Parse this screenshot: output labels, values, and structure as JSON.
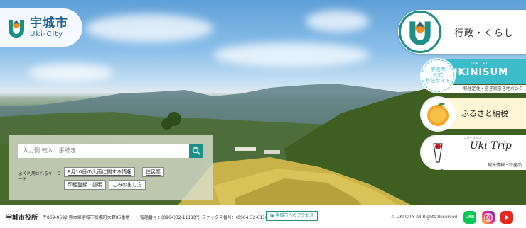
{
  "header": {
    "logo_main": "宇城市",
    "logo_sub": "Uki-City"
  },
  "side_panel": {
    "admin_label": "行政・くらし",
    "ukinisum": {
      "badge_top": "宇城市",
      "badge_mid": "公式",
      "badge_bottom": "移住サイト",
      "kana": "ウキニスム",
      "title": "UKINISUM",
      "caption": "移住定住・空き家空き地バンク"
    },
    "furusato": {
      "title": "ふるさと納税"
    },
    "ukitrip": {
      "kana": "ユキトリップ",
      "title": "Uki Trip",
      "caption": "観光情報・特産品"
    }
  },
  "search": {
    "placeholder": "入力例:転入　手続き",
    "keywords_label": "よく利用されるキーワード",
    "keywords": [
      "8月10日の大雨に関する情報",
      "住民票",
      "印鑑登録・証明",
      "ごみの出し方"
    ]
  },
  "footer": {
    "office_name": "宇城市役所",
    "address": "〒869-0592 熊本県宇城市松橋町大野85番地",
    "tel": "電話番号：(0964)32-1111(代)",
    "fax": "ファックス番号：(0964)32-0110",
    "access_link": "宇城市へのアクセス",
    "copyright": "© UKI CITY All Rights Reserved.",
    "sns": [
      "LINE",
      "Instagram",
      "YouTube"
    ]
  },
  "colors": {
    "brand_teal": "#1d8f86",
    "brand_blue": "#1d5f8f",
    "ukinisum": "#3bbcc8",
    "furusato_bg": "#fff6d6"
  }
}
